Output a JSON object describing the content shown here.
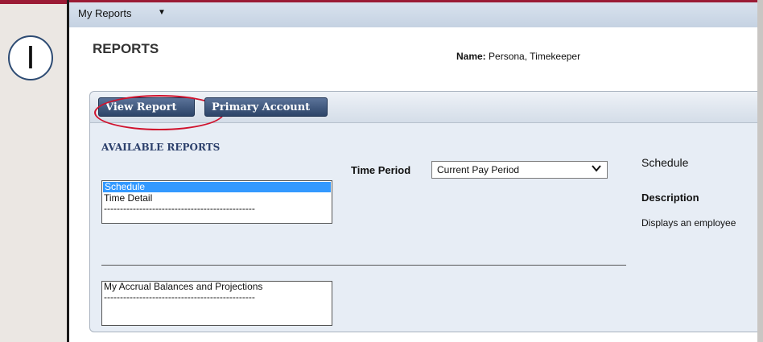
{
  "step": {
    "label": "I"
  },
  "menu": {
    "label": "My Reports"
  },
  "page": {
    "title": "REPORTS",
    "name_label": "Name:",
    "name_value": "Persona, Timekeeper"
  },
  "toolbar": {
    "view_report": "View Report",
    "primary_account": "Primary Account"
  },
  "reports": {
    "section_title": "AVAILABLE REPORTS",
    "time_period_label": "Time Period",
    "time_period_value": "Current Pay Period",
    "list1": [
      "Schedule",
      "Time Detail",
      "-----------------------------------------------"
    ],
    "list1_selected": "Schedule",
    "list2": [
      "My Accrual Balances and Projections",
      "-----------------------------------------------"
    ]
  },
  "details": {
    "title": "Schedule",
    "description_label": "Description",
    "description_text": "Displays an employee"
  },
  "colors": {
    "accent": "#9b1b35",
    "button": "#2c4468",
    "highlight": "#d0122d",
    "selection": "#3399ff"
  }
}
